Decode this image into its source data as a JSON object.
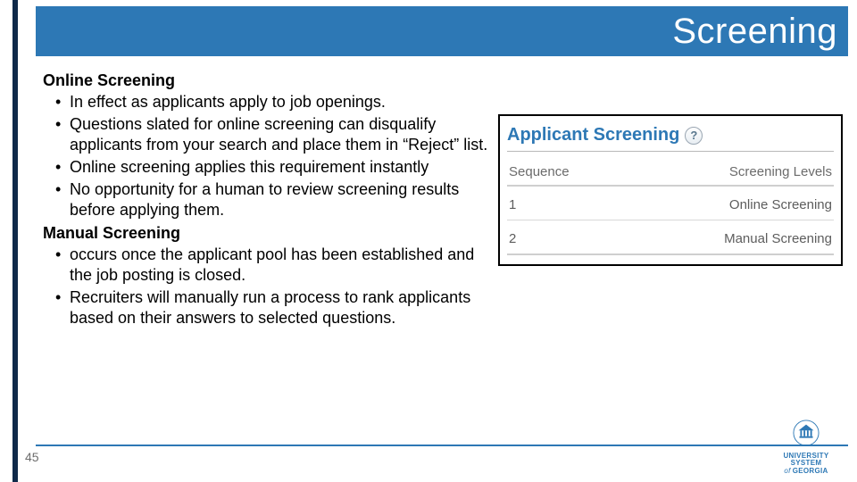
{
  "header": {
    "title": "Screening"
  },
  "body": {
    "section1": {
      "heading": "Online Screening",
      "bullets": [
        "In effect as applicants apply to job openings.",
        "Questions slated for online screening can disqualify applicants from your search and place them in “Reject” list.",
        "Online screening applies this requirement instantly",
        "No opportunity for a human to review screening results before applying them."
      ]
    },
    "section2": {
      "heading": "Manual Screening",
      "bullets": [
        "occurs once the applicant pool has been established and the job posting is closed.",
        "Recruiters will manually run a process to rank applicants based on their answers to selected questions."
      ]
    }
  },
  "figure": {
    "title": "Applicant Screening",
    "help": "?",
    "columns": {
      "seq": "Sequence",
      "level": "Screening Levels"
    },
    "rows": [
      {
        "seq": "1",
        "level": "Online Screening"
      },
      {
        "seq": "2",
        "level": "Manual Screening"
      }
    ]
  },
  "footer": {
    "page": "45",
    "logo_line1": "UNIVERSITY SYSTEM",
    "logo_of": "of",
    "logo_line2": "GEORGIA"
  }
}
